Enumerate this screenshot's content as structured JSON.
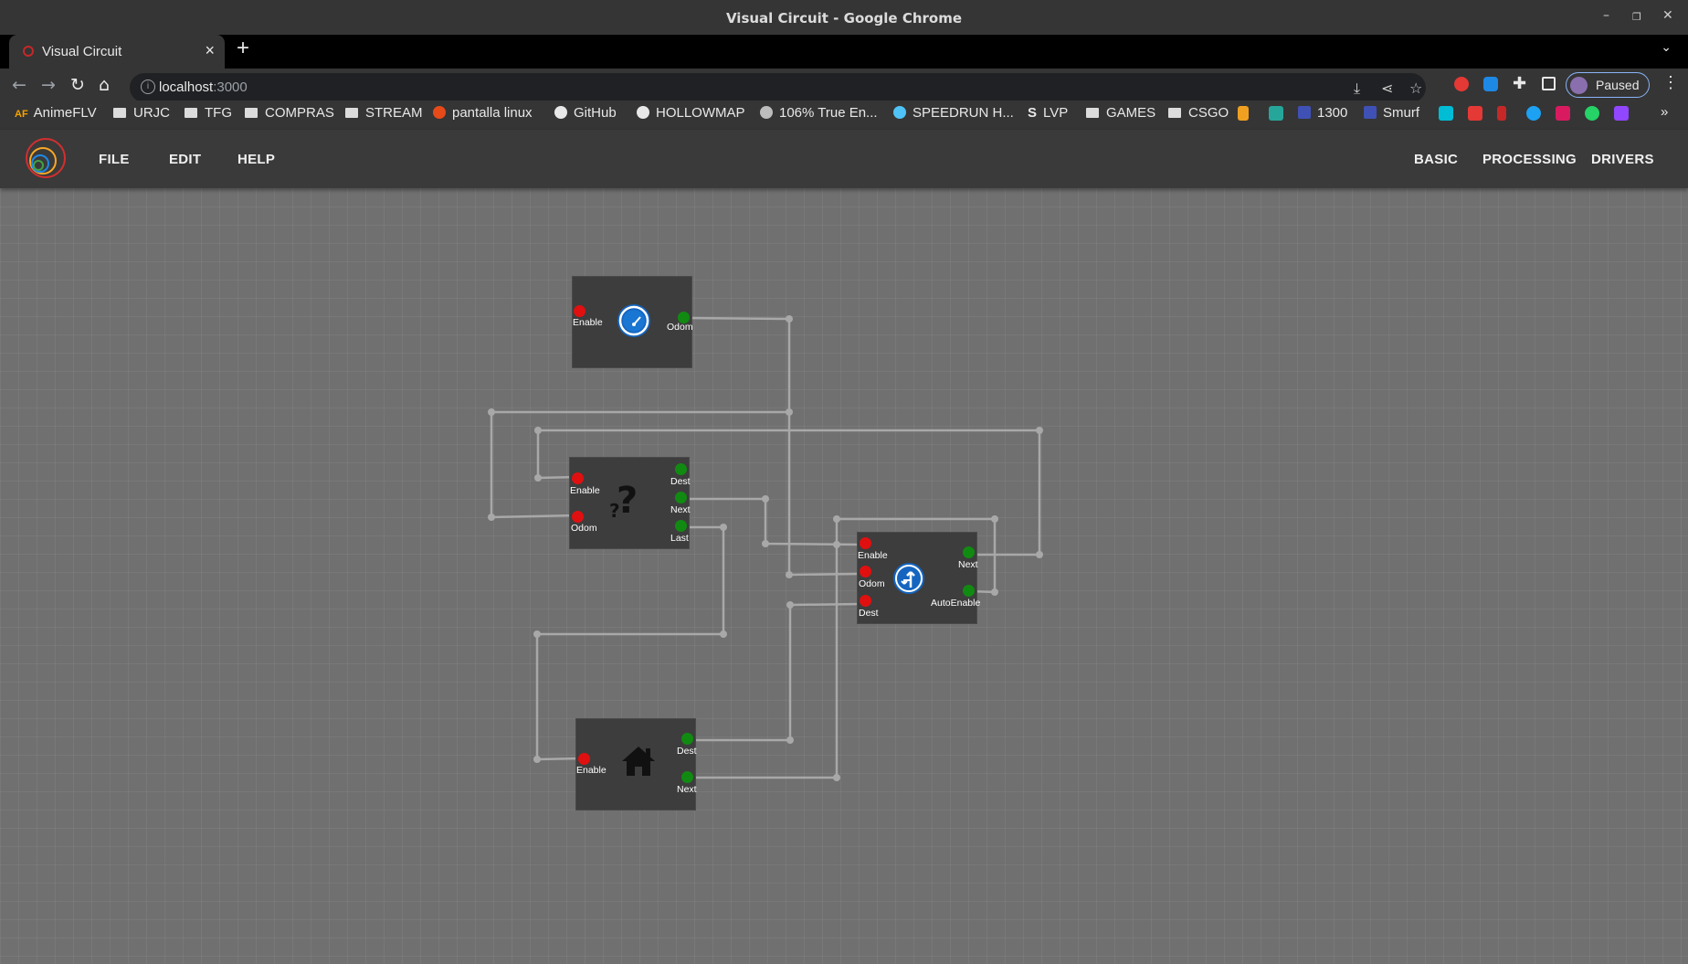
{
  "window": {
    "title": "Visual Circuit - Google Chrome"
  },
  "tab": {
    "title": "Visual Circuit"
  },
  "omnibox": {
    "host": "localhost",
    "port": ":3000"
  },
  "profile": {
    "label": "Paused"
  },
  "bookmarks": [
    "AnimeFLV",
    "URJC",
    "TFG",
    "COMPRAS",
    "STREAM",
    "pantalla linux",
    "GitHub",
    "HOLLOWMAP",
    "106% True En...",
    "SPEEDRUN H...",
    "LVP",
    "GAMES",
    "CSGO",
    "1300",
    "Smurf"
  ],
  "app": {
    "menu_left": [
      "FILE",
      "EDIT",
      "HELP"
    ],
    "menu_right": [
      "BASIC",
      "PROCESSING",
      "DRIVERS"
    ]
  },
  "blocks": {
    "odometry": {
      "icon": "gauge-icon",
      "inputs": [
        "Enable"
      ],
      "outputs": [
        "Odom"
      ]
    },
    "decision": {
      "icon": "question-mark-icon",
      "inputs": [
        "Enable",
        "Odom"
      ],
      "outputs": [
        "Dest",
        "Next",
        "Last"
      ]
    },
    "navigator": {
      "icon": "turn-sign-icon",
      "inputs": [
        "Enable",
        "Odom",
        "Dest"
      ],
      "outputs": [
        "Next",
        "AutoEnable"
      ]
    },
    "home": {
      "icon": "house-icon",
      "inputs": [
        "Enable"
      ],
      "outputs": [
        "Dest",
        "Next"
      ]
    }
  },
  "colors": {
    "input_pin": "#e01010",
    "output_pin": "#118a11",
    "canvas": "#707070",
    "block": "#3d3d3d",
    "wire": "#a8a8a8"
  }
}
